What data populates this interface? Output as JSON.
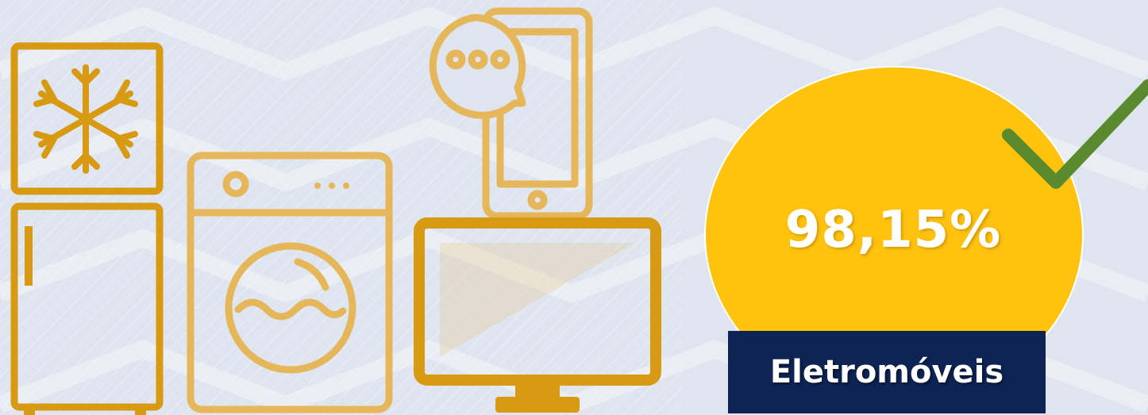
{
  "badge": {
    "percentage": "98,15%",
    "label": "Eletromóveis",
    "circle_color": "#ffc20e",
    "check_color": "#5a8a2e",
    "label_bg": "#0d2455"
  },
  "icons": {
    "color": "#d89a12",
    "light_color": "#e6b75a",
    "items": [
      "refrigerator-icon",
      "washing-machine-icon",
      "smartphone-chat-icon",
      "television-icon"
    ]
  }
}
